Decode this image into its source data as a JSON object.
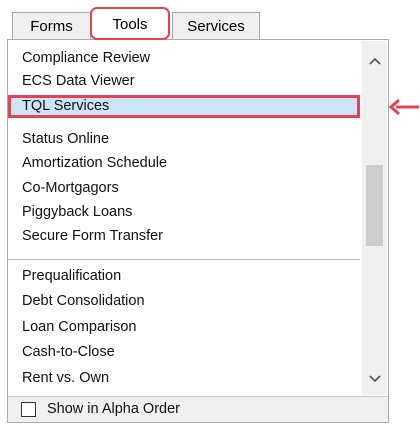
{
  "tabs": [
    {
      "label": "Forms"
    },
    {
      "label": "Tools"
    },
    {
      "label": "Services"
    }
  ],
  "active_tab": "Tools",
  "list": {
    "items": [
      {
        "label": "Compliance Review"
      },
      {
        "label": "ECS Data Viewer"
      },
      {
        "label": "TQL Services"
      },
      {
        "label": "Status Online"
      },
      {
        "label": "Amortization Schedule"
      },
      {
        "label": "Co-Mortgagors"
      },
      {
        "label": "Piggyback Loans"
      },
      {
        "label": "Secure Form Transfer"
      },
      {
        "label": "Prequalification"
      },
      {
        "label": "Debt Consolidation"
      },
      {
        "label": "Loan Comparison"
      },
      {
        "label": "Cash-to-Close"
      },
      {
        "label": "Rent vs. Own"
      }
    ],
    "selected_item": "TQL Services"
  },
  "footer": {
    "checkbox_label": "Show in Alpha Order",
    "checked": false
  },
  "icons": {
    "scroll_up": "chevron-up-icon",
    "scroll_down": "chevron-down-icon",
    "annotation": "arrow-left-icon"
  },
  "colors": {
    "highlight_border": "#e8414f",
    "selected_fill": "#cce4f7",
    "tab_background": "#f0f0f0"
  }
}
